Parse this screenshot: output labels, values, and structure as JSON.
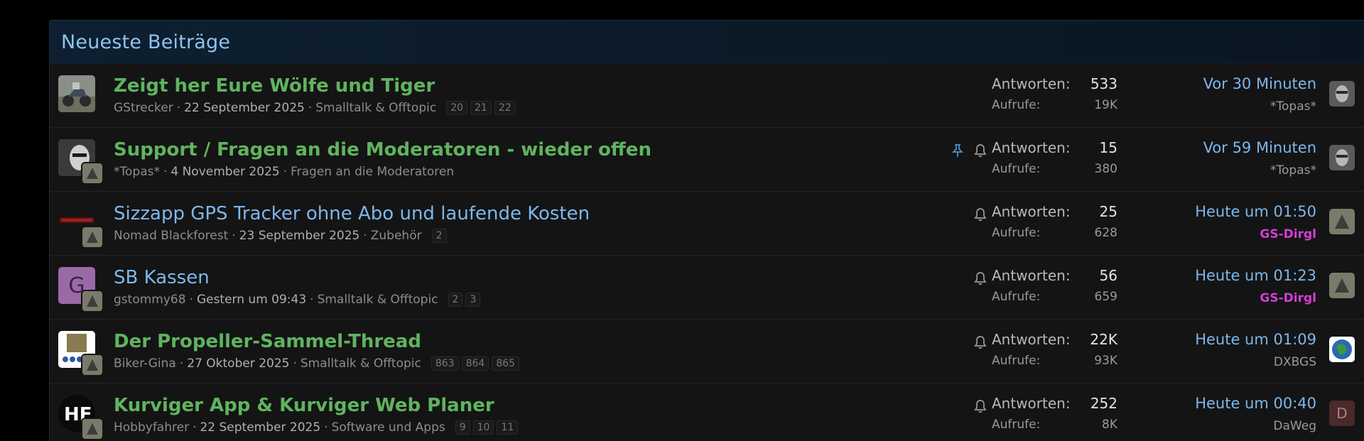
{
  "block": {
    "title": "Neueste Beiträge"
  },
  "labels": {
    "replies": "Antworten:",
    "views": "Aufrufe:"
  },
  "threads": [
    {
      "title": "Zeigt her Eure Wölfe und Tiger",
      "unread": true,
      "author": "GStrecker",
      "date": "22 September 2025",
      "forum": "Smalltalk & Offtopic",
      "pages": [
        "20",
        "21",
        "22"
      ],
      "replies": "533",
      "views": "19K",
      "last_time": "Vor 30 Minuten",
      "last_user": "*Topas*"
    },
    {
      "title": "Support / Fragen an die Moderatoren - wieder offen",
      "unread": true,
      "author": "*Topas*",
      "date": "4 November 2025",
      "forum": "Fragen an die Moderatoren",
      "pages": [],
      "replies": "15",
      "views": "380",
      "last_time": "Vor 59 Minuten",
      "last_user": "*Topas*"
    },
    {
      "title": "Sizzapp GPS Tracker ohne Abo und laufende Kosten",
      "unread": false,
      "author": "Nomad Blackforest",
      "date": "23 September 2025",
      "forum": "Zubehör",
      "pages": [
        "2"
      ],
      "replies": "25",
      "views": "628",
      "last_time": "Heute um 01:50",
      "last_user": "GS-Dirgl"
    },
    {
      "title": "SB Kassen",
      "unread": false,
      "author": "gstommy68",
      "date": "Gestern um 09:43",
      "forum": "Smalltalk & Offtopic",
      "pages": [
        "2",
        "3"
      ],
      "replies": "56",
      "views": "659",
      "last_time": "Heute um 01:23",
      "last_user": "GS-Dirgl",
      "avatar_letter": "G"
    },
    {
      "title": "Der Propeller-Sammel-Thread",
      "unread": true,
      "author": "Biker-Gina",
      "date": "27 Oktober 2025",
      "forum": "Smalltalk & Offtopic",
      "pages": [
        "863",
        "864",
        "865"
      ],
      "replies": "22K",
      "views": "93K",
      "last_time": "Heute um 01:09",
      "last_user": "DXBGS"
    },
    {
      "title": "Kurviger App & Kurviger Web Planer",
      "unread": true,
      "author": "Hobbyfahrer",
      "date": "22 September 2025",
      "forum": "Software und Apps",
      "pages": [
        "9",
        "10",
        "11"
      ],
      "replies": "252",
      "views": "8K",
      "last_time": "Heute um 00:40",
      "last_user": "DaWeg",
      "last_avatar_letter": "D"
    }
  ],
  "colors": {
    "unread_title": "#5fb45f",
    "read_title": "#7db7ec",
    "highlight_user": "#d23fd6",
    "header_text": "#8fc3f0"
  },
  "icons": [
    "pin-icon",
    "bell-icon"
  ]
}
